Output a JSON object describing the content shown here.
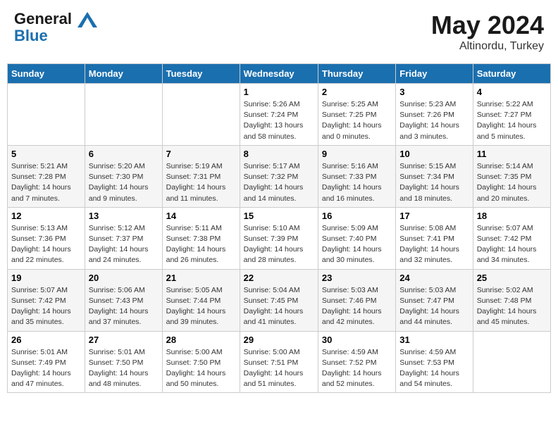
{
  "header": {
    "logo_line1": "General",
    "logo_line2": "Blue",
    "month": "May 2024",
    "location": "Altinordu, Turkey"
  },
  "days_of_week": [
    "Sunday",
    "Monday",
    "Tuesday",
    "Wednesday",
    "Thursday",
    "Friday",
    "Saturday"
  ],
  "weeks": [
    [
      {
        "day": "",
        "info": ""
      },
      {
        "day": "",
        "info": ""
      },
      {
        "day": "",
        "info": ""
      },
      {
        "day": "1",
        "info": "Sunrise: 5:26 AM\nSunset: 7:24 PM\nDaylight: 13 hours\nand 58 minutes."
      },
      {
        "day": "2",
        "info": "Sunrise: 5:25 AM\nSunset: 7:25 PM\nDaylight: 14 hours\nand 0 minutes."
      },
      {
        "day": "3",
        "info": "Sunrise: 5:23 AM\nSunset: 7:26 PM\nDaylight: 14 hours\nand 3 minutes."
      },
      {
        "day": "4",
        "info": "Sunrise: 5:22 AM\nSunset: 7:27 PM\nDaylight: 14 hours\nand 5 minutes."
      }
    ],
    [
      {
        "day": "5",
        "info": "Sunrise: 5:21 AM\nSunset: 7:28 PM\nDaylight: 14 hours\nand 7 minutes."
      },
      {
        "day": "6",
        "info": "Sunrise: 5:20 AM\nSunset: 7:30 PM\nDaylight: 14 hours\nand 9 minutes."
      },
      {
        "day": "7",
        "info": "Sunrise: 5:19 AM\nSunset: 7:31 PM\nDaylight: 14 hours\nand 11 minutes."
      },
      {
        "day": "8",
        "info": "Sunrise: 5:17 AM\nSunset: 7:32 PM\nDaylight: 14 hours\nand 14 minutes."
      },
      {
        "day": "9",
        "info": "Sunrise: 5:16 AM\nSunset: 7:33 PM\nDaylight: 14 hours\nand 16 minutes."
      },
      {
        "day": "10",
        "info": "Sunrise: 5:15 AM\nSunset: 7:34 PM\nDaylight: 14 hours\nand 18 minutes."
      },
      {
        "day": "11",
        "info": "Sunrise: 5:14 AM\nSunset: 7:35 PM\nDaylight: 14 hours\nand 20 minutes."
      }
    ],
    [
      {
        "day": "12",
        "info": "Sunrise: 5:13 AM\nSunset: 7:36 PM\nDaylight: 14 hours\nand 22 minutes."
      },
      {
        "day": "13",
        "info": "Sunrise: 5:12 AM\nSunset: 7:37 PM\nDaylight: 14 hours\nand 24 minutes."
      },
      {
        "day": "14",
        "info": "Sunrise: 5:11 AM\nSunset: 7:38 PM\nDaylight: 14 hours\nand 26 minutes."
      },
      {
        "day": "15",
        "info": "Sunrise: 5:10 AM\nSunset: 7:39 PM\nDaylight: 14 hours\nand 28 minutes."
      },
      {
        "day": "16",
        "info": "Sunrise: 5:09 AM\nSunset: 7:40 PM\nDaylight: 14 hours\nand 30 minutes."
      },
      {
        "day": "17",
        "info": "Sunrise: 5:08 AM\nSunset: 7:41 PM\nDaylight: 14 hours\nand 32 minutes."
      },
      {
        "day": "18",
        "info": "Sunrise: 5:07 AM\nSunset: 7:42 PM\nDaylight: 14 hours\nand 34 minutes."
      }
    ],
    [
      {
        "day": "19",
        "info": "Sunrise: 5:07 AM\nSunset: 7:42 PM\nDaylight: 14 hours\nand 35 minutes."
      },
      {
        "day": "20",
        "info": "Sunrise: 5:06 AM\nSunset: 7:43 PM\nDaylight: 14 hours\nand 37 minutes."
      },
      {
        "day": "21",
        "info": "Sunrise: 5:05 AM\nSunset: 7:44 PM\nDaylight: 14 hours\nand 39 minutes."
      },
      {
        "day": "22",
        "info": "Sunrise: 5:04 AM\nSunset: 7:45 PM\nDaylight: 14 hours\nand 41 minutes."
      },
      {
        "day": "23",
        "info": "Sunrise: 5:03 AM\nSunset: 7:46 PM\nDaylight: 14 hours\nand 42 minutes."
      },
      {
        "day": "24",
        "info": "Sunrise: 5:03 AM\nSunset: 7:47 PM\nDaylight: 14 hours\nand 44 minutes."
      },
      {
        "day": "25",
        "info": "Sunrise: 5:02 AM\nSunset: 7:48 PM\nDaylight: 14 hours\nand 45 minutes."
      }
    ],
    [
      {
        "day": "26",
        "info": "Sunrise: 5:01 AM\nSunset: 7:49 PM\nDaylight: 14 hours\nand 47 minutes."
      },
      {
        "day": "27",
        "info": "Sunrise: 5:01 AM\nSunset: 7:50 PM\nDaylight: 14 hours\nand 48 minutes."
      },
      {
        "day": "28",
        "info": "Sunrise: 5:00 AM\nSunset: 7:50 PM\nDaylight: 14 hours\nand 50 minutes."
      },
      {
        "day": "29",
        "info": "Sunrise: 5:00 AM\nSunset: 7:51 PM\nDaylight: 14 hours\nand 51 minutes."
      },
      {
        "day": "30",
        "info": "Sunrise: 4:59 AM\nSunset: 7:52 PM\nDaylight: 14 hours\nand 52 minutes."
      },
      {
        "day": "31",
        "info": "Sunrise: 4:59 AM\nSunset: 7:53 PM\nDaylight: 14 hours\nand 54 minutes."
      },
      {
        "day": "",
        "info": ""
      }
    ]
  ]
}
